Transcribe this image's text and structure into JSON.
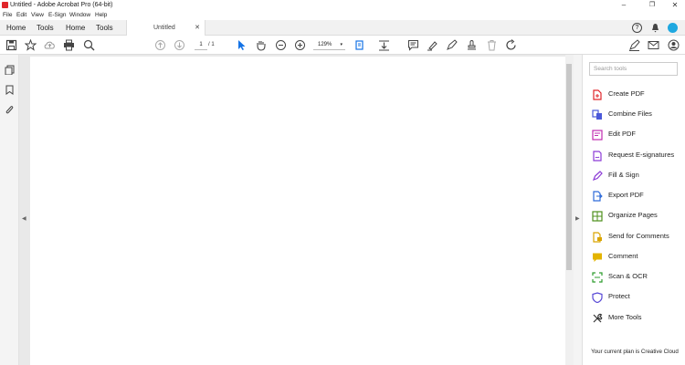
{
  "window": {
    "title": "Untitled - Adobe Acrobat Pro (64-bit)"
  },
  "menu": {
    "items": [
      "File",
      "Edit",
      "View",
      "E-Sign",
      "Window",
      "Help"
    ]
  },
  "tabs": {
    "home1": "Home",
    "tools": "Tools",
    "home2": "Home",
    "tools2": "Tools",
    "document": "Untitled"
  },
  "toolbar": {
    "page_current": "1",
    "page_total": "/ 1",
    "zoom": "129%"
  },
  "rightpanel": {
    "search_placeholder": "Search tools",
    "tools": [
      {
        "label": "Create PDF",
        "icon": "create-pdf-icon",
        "color": "#e0262b"
      },
      {
        "label": "Combine Files",
        "icon": "combine-files-icon",
        "color": "#4b59d9"
      },
      {
        "label": "Edit PDF",
        "icon": "edit-pdf-icon",
        "color": "#c02bb0"
      },
      {
        "label": "Request E-signatures",
        "icon": "request-esignatures-icon",
        "color": "#8c3bd6"
      },
      {
        "label": "Fill & Sign",
        "icon": "fill-sign-icon",
        "color": "#8c3bd6"
      },
      {
        "label": "Export PDF",
        "icon": "export-pdf-icon",
        "color": "#2e6bd9"
      },
      {
        "label": "Organize Pages",
        "icon": "organize-pages-icon",
        "color": "#4d8f1b"
      },
      {
        "label": "Send for Comments",
        "icon": "send-for-comments-icon",
        "color": "#d9a400"
      },
      {
        "label": "Comment",
        "icon": "comment-icon",
        "color": "#e3b400"
      },
      {
        "label": "Scan & OCR",
        "icon": "scan-ocr-icon",
        "color": "#2d9c2d"
      },
      {
        "label": "Protect",
        "icon": "protect-icon",
        "color": "#5a4bd6"
      },
      {
        "label": "More Tools",
        "icon": "more-tools-icon",
        "color": "#333333"
      }
    ],
    "plan_text": "Your current plan is Creative Cloud"
  },
  "colors": {
    "accent": "#1473e6",
    "avatar": "#1fa8e0"
  }
}
